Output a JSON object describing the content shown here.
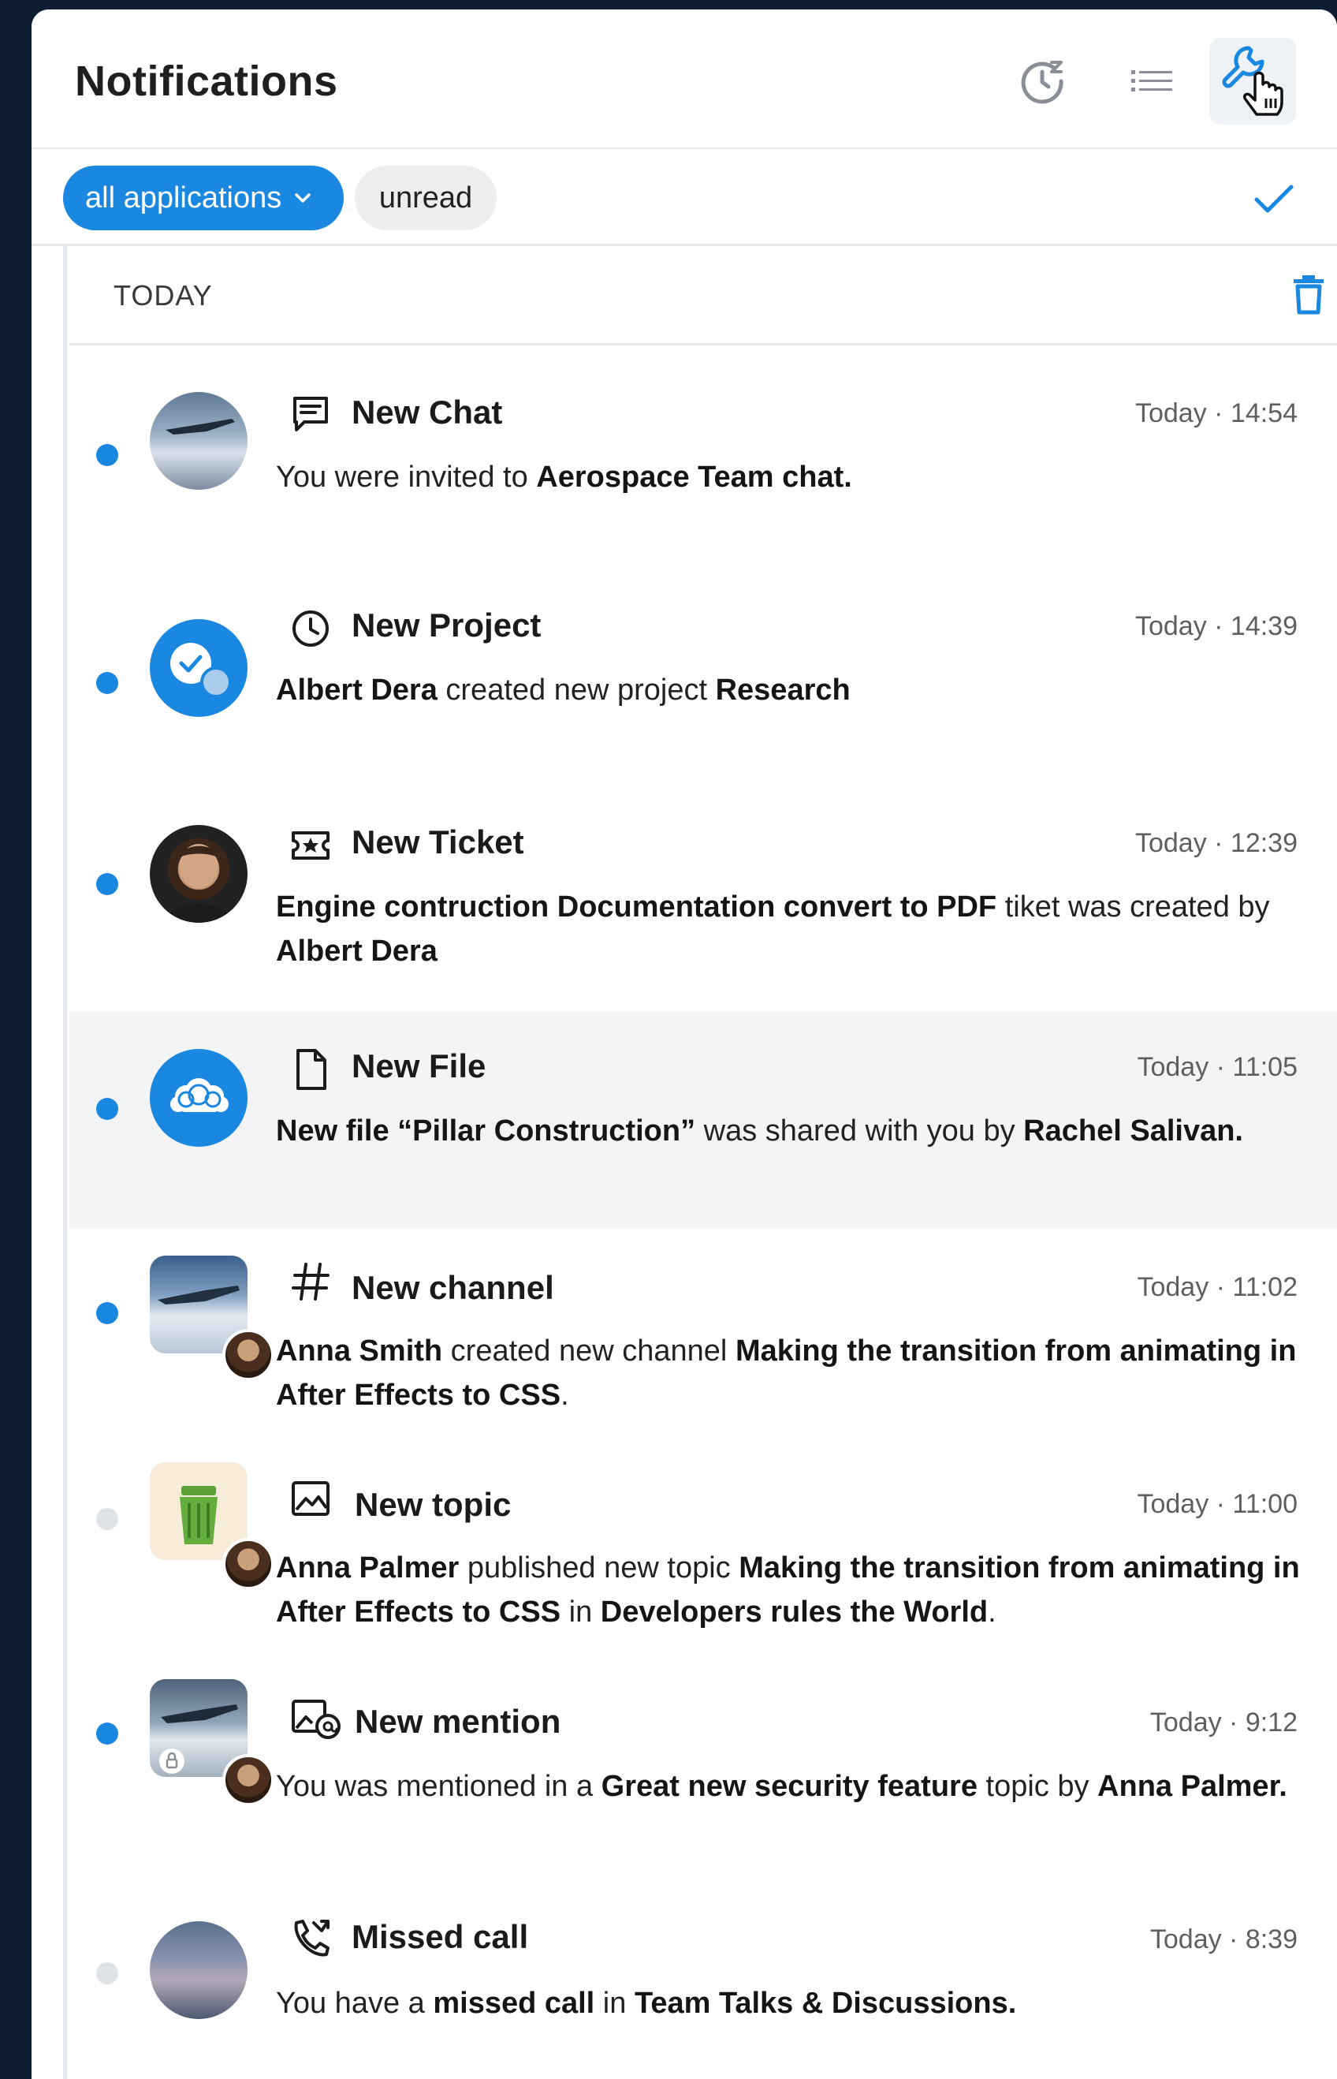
{
  "header": {
    "title": "Notifications"
  },
  "filters": {
    "primary_label": "all applications",
    "secondary_label": "unread"
  },
  "section": {
    "label": "TODAY"
  },
  "colors": {
    "accent": "#1a87e0",
    "unread_dot": "#1a87e0",
    "read_dot": "#dfe3e8"
  },
  "notifications": [
    {
      "icon": "chat-icon",
      "title": "New Chat",
      "time": "Today · 14:54",
      "unread": true,
      "body": [
        {
          "t": "You were invited to "
        },
        {
          "t": "Aerospace Team chat.",
          "b": true
        }
      ]
    },
    {
      "icon": "clock-icon",
      "title": "New Project",
      "time": "Today · 14:39",
      "unread": true,
      "body": [
        {
          "t": "Albert Dera",
          "b": true
        },
        {
          "t": " created new project "
        },
        {
          "t": "Research",
          "b": true
        }
      ]
    },
    {
      "icon": "ticket-icon",
      "title": "New Ticket",
      "time": "Today · 12:39",
      "unread": true,
      "body": [
        {
          "t": "Engine contruction Documentation convert to PDF",
          "b": true
        },
        {
          "t": " tiket was created by "
        },
        {
          "t": "Albert Dera",
          "b": true
        }
      ]
    },
    {
      "icon": "file-icon",
      "title": "New File",
      "time": "Today · 11:05",
      "unread": true,
      "highlight": true,
      "body": [
        {
          "t": "New file “Pillar Construction”",
          "b": true
        },
        {
          "t": " was shared with you by "
        },
        {
          "t": "Rachel Salivan.",
          "b": true
        }
      ]
    },
    {
      "icon": "hash-icon",
      "title": "New channel",
      "time": "Today · 11:02",
      "unread": true,
      "body": [
        {
          "t": "Anna Smith",
          "b": true
        },
        {
          "t": " created new channel "
        },
        {
          "t": "Making the transition from animating in After Effects to CSS",
          "b": true
        },
        {
          "t": "."
        }
      ]
    },
    {
      "icon": "image-icon",
      "title": "New topic",
      "time": "Today · 11:00",
      "unread": false,
      "body": [
        {
          "t": "Anna Palmer",
          "b": true
        },
        {
          "t": " published new topic "
        },
        {
          "t": "Making the transition from animating in After Effects to CSS",
          "b": true
        },
        {
          "t": " in "
        },
        {
          "t": "Developers rules the World",
          "b": true
        },
        {
          "t": "."
        }
      ]
    },
    {
      "icon": "mention-icon",
      "title": "New mention",
      "time": "Today · 9:12",
      "unread": true,
      "body": [
        {
          "t": "You was mentioned in a "
        },
        {
          "t": "Great new security feature",
          "b": true
        },
        {
          "t": " topic by "
        },
        {
          "t": "Anna Palmer.",
          "b": true
        }
      ]
    },
    {
      "icon": "missed-call-icon",
      "title": "Missed call",
      "time": "Today · 8:39",
      "unread": false,
      "body": [
        {
          "t": "You have a "
        },
        {
          "t": "missed call",
          "b": true
        },
        {
          "t": " in "
        },
        {
          "t": "Team Talks & Discussions.",
          "b": true
        }
      ]
    }
  ]
}
